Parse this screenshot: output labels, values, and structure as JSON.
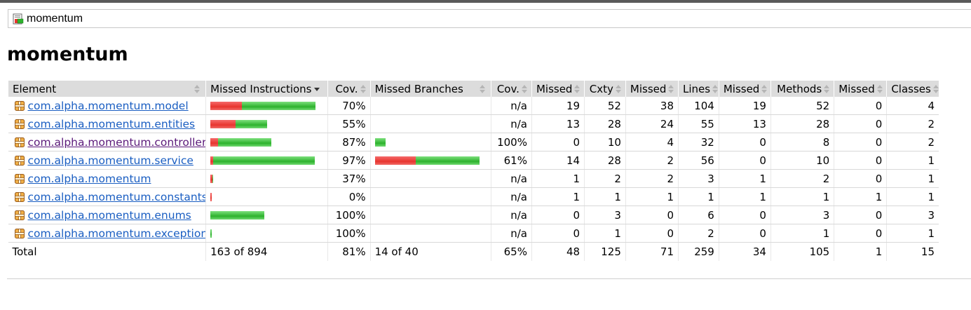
{
  "breadcrumb": {
    "icon": "report-icon",
    "label": "momentum"
  },
  "page_title": "momentum",
  "table": {
    "headers": [
      {
        "label": "Element",
        "align": "left"
      },
      {
        "label": "Missed Instructions",
        "align": "left",
        "sort": "desc"
      },
      {
        "label": "Cov."
      },
      {
        "label": "Missed Branches",
        "align": "left"
      },
      {
        "label": "Cov."
      },
      {
        "label": "Missed"
      },
      {
        "label": "Cxty"
      },
      {
        "label": "Missed"
      },
      {
        "label": "Lines"
      },
      {
        "label": "Missed"
      },
      {
        "label": "Methods"
      },
      {
        "label": "Missed"
      },
      {
        "label": "Classes"
      }
    ],
    "rows": [
      {
        "name": "com.alpha.momentum.model",
        "visited": false,
        "instr_missed_frac": 0.3,
        "instr_total_frac": 1.0,
        "instr_cov": "70%",
        "branch_missed_frac": null,
        "branch_total_frac": null,
        "branch_cov": "n/a",
        "cxty_missed": "19",
        "cxty": "52",
        "lines_missed": "38",
        "lines": "104",
        "methods_missed": "19",
        "methods": "52",
        "classes_missed": "0",
        "classes": "4"
      },
      {
        "name": "com.alpha.momentum.entities",
        "visited": false,
        "instr_missed_frac": 0.45,
        "instr_total_frac": 0.54,
        "instr_cov": "55%",
        "branch_missed_frac": null,
        "branch_total_frac": null,
        "branch_cov": "n/a",
        "cxty_missed": "13",
        "cxty": "28",
        "lines_missed": "24",
        "lines": "55",
        "methods_missed": "13",
        "methods": "28",
        "classes_missed": "0",
        "classes": "2"
      },
      {
        "name": "com.alpha.momentum.controller",
        "visited": true,
        "instr_missed_frac": 0.13,
        "instr_total_frac": 0.58,
        "instr_cov": "87%",
        "branch_missed_frac": 0.0,
        "branch_total_frac": 0.1,
        "branch_cov": "100%",
        "cxty_missed": "0",
        "cxty": "10",
        "lines_missed": "4",
        "lines": "32",
        "methods_missed": "0",
        "methods": "8",
        "classes_missed": "0",
        "classes": "2"
      },
      {
        "name": "com.alpha.momentum.service",
        "visited": false,
        "instr_missed_frac": 0.03,
        "instr_total_frac": 0.99,
        "instr_cov": "97%",
        "branch_missed_frac": 0.39,
        "branch_total_frac": 1.0,
        "branch_cov": "61%",
        "cxty_missed": "14",
        "cxty": "28",
        "lines_missed": "2",
        "lines": "56",
        "methods_missed": "0",
        "methods": "10",
        "classes_missed": "0",
        "classes": "1"
      },
      {
        "name": "com.alpha.momentum",
        "visited": false,
        "instr_missed_frac": 0.63,
        "instr_total_frac": 0.025,
        "instr_cov": "37%",
        "branch_missed_frac": null,
        "branch_total_frac": null,
        "branch_cov": "n/a",
        "cxty_missed": "1",
        "cxty": "2",
        "lines_missed": "2",
        "lines": "3",
        "methods_missed": "1",
        "methods": "2",
        "classes_missed": "0",
        "classes": "1"
      },
      {
        "name": "com.alpha.momentum.constants",
        "visited": false,
        "instr_missed_frac": 1.0,
        "instr_total_frac": 0.012,
        "instr_cov": "0%",
        "branch_missed_frac": null,
        "branch_total_frac": null,
        "branch_cov": "n/a",
        "cxty_missed": "1",
        "cxty": "1",
        "lines_missed": "1",
        "lines": "1",
        "methods_missed": "1",
        "methods": "1",
        "classes_missed": "1",
        "classes": "1"
      },
      {
        "name": "com.alpha.momentum.enums",
        "visited": false,
        "instr_missed_frac": 0.0,
        "instr_total_frac": 0.51,
        "instr_cov": "100%",
        "branch_missed_frac": null,
        "branch_total_frac": null,
        "branch_cov": "n/a",
        "cxty_missed": "0",
        "cxty": "3",
        "lines_missed": "0",
        "lines": "6",
        "methods_missed": "0",
        "methods": "3",
        "classes_missed": "0",
        "classes": "3"
      },
      {
        "name": "com.alpha.momentum.exception",
        "visited": false,
        "instr_missed_frac": 0.0,
        "instr_total_frac": 0.012,
        "instr_cov": "100%",
        "branch_missed_frac": null,
        "branch_total_frac": null,
        "branch_cov": "n/a",
        "cxty_missed": "0",
        "cxty": "1",
        "lines_missed": "0",
        "lines": "2",
        "methods_missed": "0",
        "methods": "1",
        "classes_missed": "0",
        "classes": "1"
      }
    ],
    "total": {
      "label": "Total",
      "instr": "163 of 894",
      "instr_cov": "81%",
      "branch": "14 of 40",
      "branch_cov": "65%",
      "cxty_missed": "48",
      "cxty": "125",
      "lines_missed": "71",
      "lines": "259",
      "methods_missed": "34",
      "methods": "105",
      "classes_missed": "1",
      "classes": "15"
    }
  },
  "colors": {
    "missed": "#e8352f",
    "covered": "#2db22d",
    "link": "#1a5ec2",
    "visited_link": "#5b1a7a"
  }
}
